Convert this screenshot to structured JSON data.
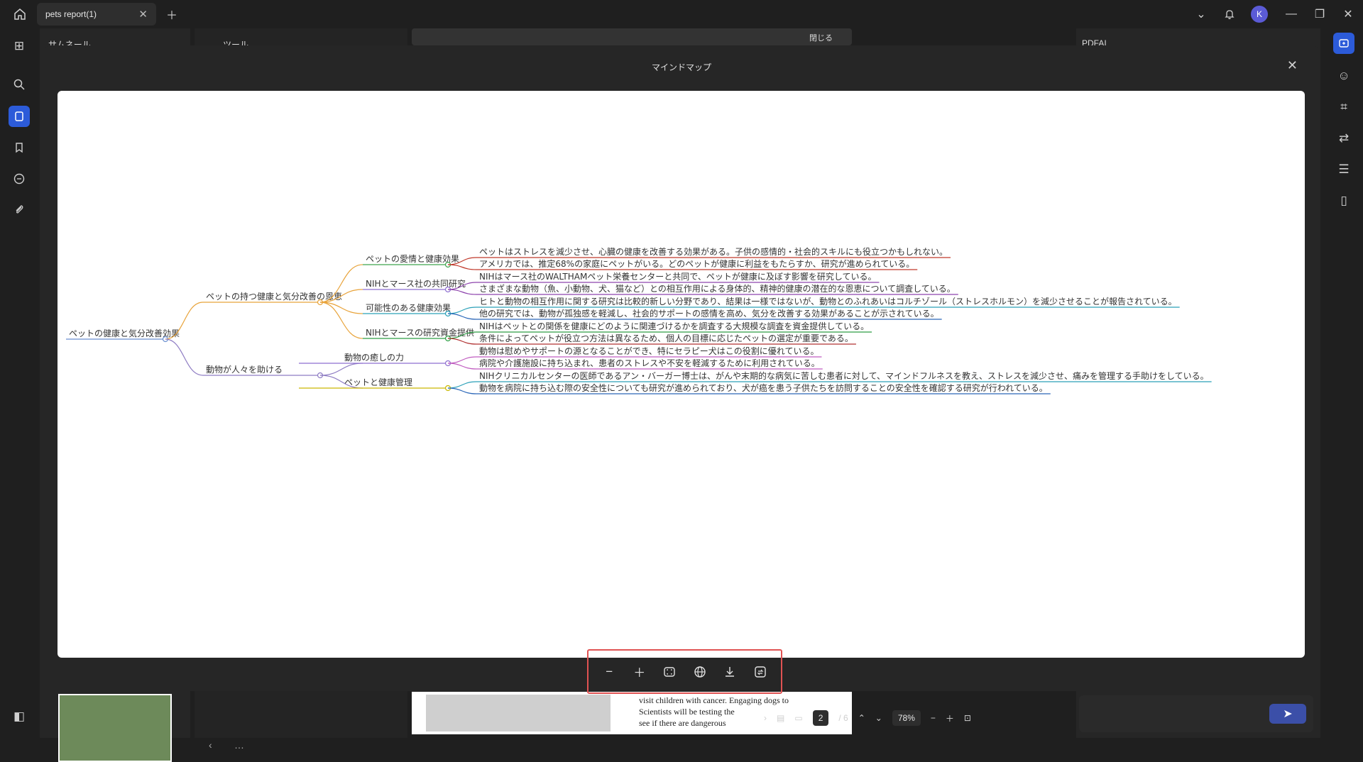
{
  "titlebar": {
    "tab_title": "pets report(1)",
    "avatar_initial": "K"
  },
  "background": {
    "left_panel_title": "サムネール",
    "tools_label": "ツール",
    "close_label": "閉じる",
    "right_panel_title": "PDFAI",
    "doc_text_lines": [
      "visit children with cancer. Engaging dogs to",
      "Scientists will be testing the",
      "see if there are dangerous"
    ]
  },
  "modal": {
    "title": "マインドマップ"
  },
  "mindmap": {
    "root": "ペットの健康と気分改善効果",
    "branches": [
      {
        "label": "ペットの持つ健康と気分改善の恩恵",
        "children": [
          {
            "label": "ペットの愛情と健康効果",
            "leaves": [
              "ペットはストレスを減少させ、心臓の健康を改善する効果がある。子供の感情的・社会的スキルにも役立つかもしれない。",
              "アメリカでは、推定68%の家庭にペットがいる。どのペットが健康に利益をもたらすか、研究が進められている。"
            ]
          },
          {
            "label": "NIHとマース社の共同研究",
            "leaves": [
              "NIHはマース社のWALTHAMペット栄養センターと共同で、ペットが健康に及ぼす影響を研究している。",
              "さまざまな動物（魚、小動物、犬、猫など）との相互作用による身体的、精神的健康の潜在的な恩恵について調査している。"
            ]
          },
          {
            "label": "可能性のある健康効果",
            "leaves": [
              "ヒトと動物の相互作用に関する研究は比較的新しい分野であり、結果は一様ではないが、動物とのふれあいはコルチゾール（ストレスホルモン）を減少させることが報告されている。",
              "他の研究では、動物が孤独感を軽減し、社会的サポートの感情を高め、気分を改善する効果があることが示されている。"
            ]
          },
          {
            "label": "NIHとマースの研究資金提供",
            "leaves": [
              "NIHはペットとの関係を健康にどのように関連づけるかを調査する大規模な調査を資金提供している。",
              "条件によってペットが役立つ方法は異なるため、個人の目標に応じたペットの選定が重要である。"
            ]
          }
        ]
      },
      {
        "label": "動物が人々を助ける",
        "children": [
          {
            "label": "動物の癒しの力",
            "leaves": [
              "動物は慰めやサポートの源となることができ、特にセラピー犬はこの役割に優れている。",
              "病院や介護施設に持ち込まれ、患者のストレスや不安を軽減するために利用されている。"
            ]
          },
          {
            "label": "ペットと健康管理",
            "leaves": [
              "NIHクリニカルセンターの医師であるアン・バーガー博士は、がんや末期的な病気に苦しむ患者に対して、マインドフルネスを教え、ストレスを減少させ、痛みを管理する手助けをしている。",
              "動物を病院に持ち込む際の安全性についても研究が進められており、犬が癌を患う子供たちを訪問することの安全性を確認する研究が行われている。"
            ]
          }
        ]
      }
    ]
  },
  "statusbar": {
    "current_page": "2",
    "total_pages": "/ 6",
    "zoom": "78%"
  },
  "colors": {
    "accent": "#2c5bd9",
    "highlight_border": "#e05252",
    "branch1": "#e8a33a",
    "branch2": "#8e7cc3"
  }
}
